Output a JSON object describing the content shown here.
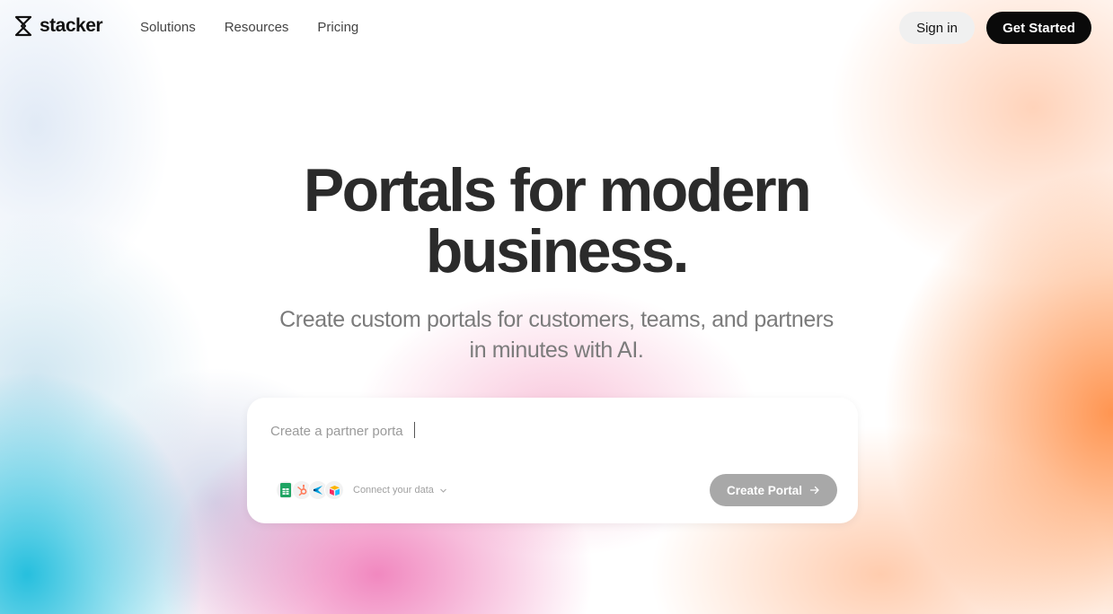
{
  "brand": {
    "name": "stacker",
    "logo_icon": "stacker-logo-icon"
  },
  "nav": {
    "links": [
      "Solutions",
      "Resources",
      "Pricing"
    ],
    "signin_label": "Sign in",
    "get_started_label": "Get Started"
  },
  "hero": {
    "title_line1": "Portals for modern",
    "title_line2": "business.",
    "subtitle_line1": "Create custom portals for customers, teams, and partners",
    "subtitle_line2": "in minutes with AI."
  },
  "prompt": {
    "placeholder": "Create a partner porta",
    "value": "",
    "connect_label": "Connect your data",
    "data_sources": [
      "google-sheets-icon",
      "hubspot-icon",
      "salesforce-icon",
      "airtable-icon"
    ],
    "create_label": "Create Portal",
    "create_icon": "arrow-right-icon"
  },
  "colors": {
    "primary_button": "#0a0a0a",
    "secondary_button": "#f0f0f0",
    "disabled_button": "#a8a8a8",
    "title_text": "#2b2b2b",
    "subtitle_text": "#7b7b7b"
  }
}
